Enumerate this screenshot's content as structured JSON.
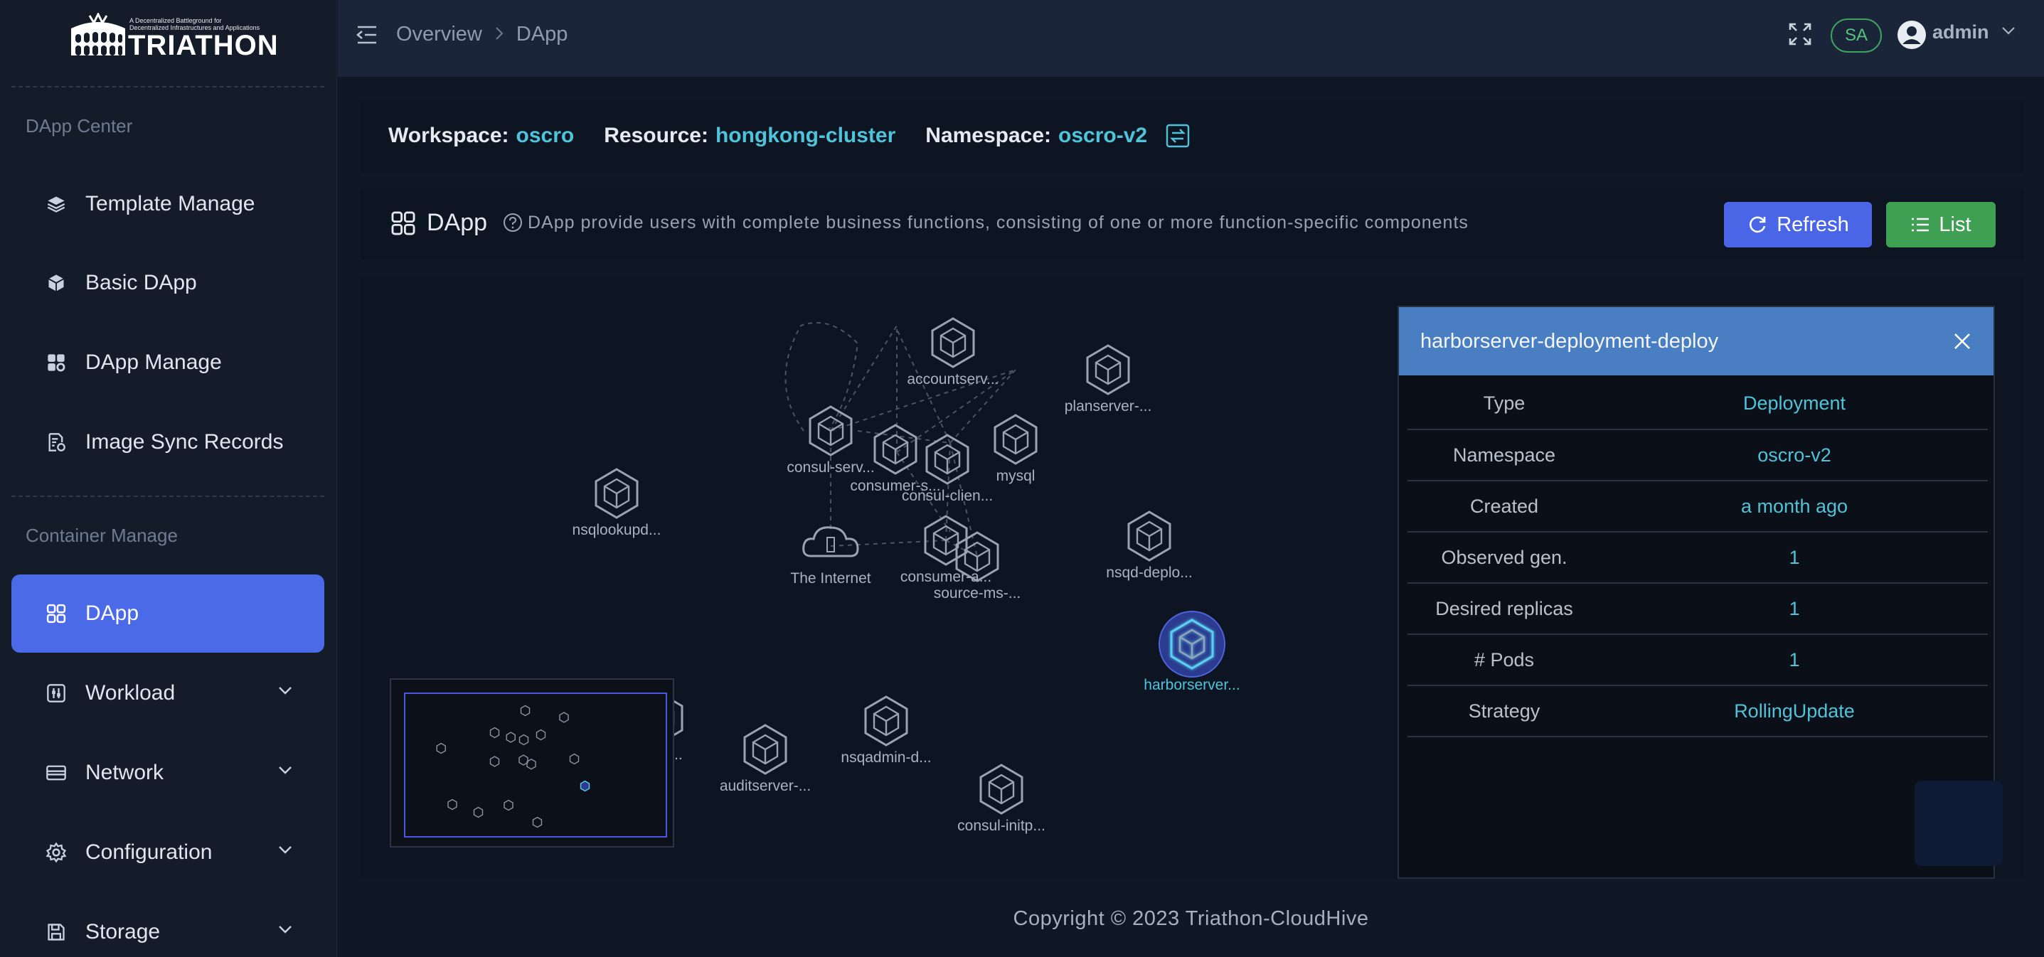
{
  "brand": {
    "name": "TRIATHON",
    "tagline_line1": "A Decentralized Battleground for",
    "tagline_line2": "Decentralized Infrastructures and Applications"
  },
  "sidebar": {
    "sections": [
      {
        "label": "DApp Center",
        "items": [
          {
            "label": "Template Manage",
            "icon": "layers-icon"
          },
          {
            "label": "Basic DApp",
            "icon": "cube-icon"
          },
          {
            "label": "DApp Manage",
            "icon": "apps-settings-icon"
          },
          {
            "label": "Image Sync Records",
            "icon": "document-sync-icon"
          }
        ]
      },
      {
        "label": "Container Manage",
        "items": [
          {
            "label": "DApp",
            "icon": "grid-icon",
            "active": true
          },
          {
            "label": "Workload",
            "icon": "sliders-icon",
            "expandable": true
          },
          {
            "label": "Network",
            "icon": "card-icon",
            "expandable": true
          },
          {
            "label": "Configuration",
            "icon": "gear-icon",
            "expandable": true
          },
          {
            "label": "Storage",
            "icon": "save-icon",
            "expandable": true
          }
        ]
      }
    ]
  },
  "header": {
    "breadcrumb": [
      "Overview",
      "DApp"
    ],
    "role_badge": "SA",
    "username": "admin"
  },
  "workspace_bar": {
    "workspace_label": "Workspace:",
    "workspace": "oscro",
    "resource_label": "Resource:",
    "resource": "hongkong-cluster",
    "namespace_label": "Namespace:",
    "namespace": "oscro-v2"
  },
  "dapp_panel": {
    "title": "DApp",
    "description": "DApp provide users with complete business functions, consisting of one or more function-specific components",
    "refresh_label": "Refresh",
    "list_label": "List"
  },
  "graph": {
    "nodes": [
      {
        "id": "accountserv",
        "label": "accountserv...",
        "type": "cube"
      },
      {
        "id": "planserver",
        "label": "planserver-...",
        "type": "cube"
      },
      {
        "id": "consul-serv",
        "label": "consul-serv...",
        "type": "cube"
      },
      {
        "id": "consumer-s",
        "label": "consumer-s...",
        "type": "cube"
      },
      {
        "id": "consul-clien",
        "label": "consul-clien...",
        "type": "cube"
      },
      {
        "id": "mysql",
        "label": "mysql",
        "type": "cube"
      },
      {
        "id": "nsqlookupd",
        "label": "nsqlookupd...",
        "type": "cube"
      },
      {
        "id": "internet",
        "label": "The Internet",
        "type": "cloud"
      },
      {
        "id": "consumer-a",
        "label": "consumer-a...",
        "type": "cube"
      },
      {
        "id": "source-ms",
        "label": "source-ms-...",
        "type": "cube"
      },
      {
        "id": "nsqd-deplo",
        "label": "nsqd-deplo...",
        "type": "cube"
      },
      {
        "id": "harborserver",
        "label": "harborserver...",
        "type": "cube",
        "selected": true
      },
      {
        "id": "web-d",
        "label": "eb-d...",
        "type": "cube"
      },
      {
        "id": "auditserver",
        "label": "auditserver-...",
        "type": "cube"
      },
      {
        "id": "nsqadmin",
        "label": "nsqadmin-d...",
        "type": "cube"
      },
      {
        "id": "consul-initp",
        "label": "consul-initp...",
        "type": "cube"
      }
    ]
  },
  "detail": {
    "title": "harborserver-deployment-deploy",
    "rows": [
      {
        "key": "Type",
        "value": "Deployment"
      },
      {
        "key": "Namespace",
        "value": "oscro-v2"
      },
      {
        "key": "Created",
        "value": "a month ago"
      },
      {
        "key": "Observed gen.",
        "value": "1"
      },
      {
        "key": "Desired replicas",
        "value": "1"
      },
      {
        "key": "# Pods",
        "value": "1"
      },
      {
        "key": "Strategy",
        "value": "RollingUpdate"
      }
    ]
  },
  "footer": {
    "copyright": "Copyright © 2023 Triathon-CloudHive"
  },
  "colors": {
    "accent_blue": "#4b6ae8",
    "link_cyan": "#4fc3d9",
    "list_green": "#3f9f52",
    "detail_header": "#4a7ec2"
  }
}
